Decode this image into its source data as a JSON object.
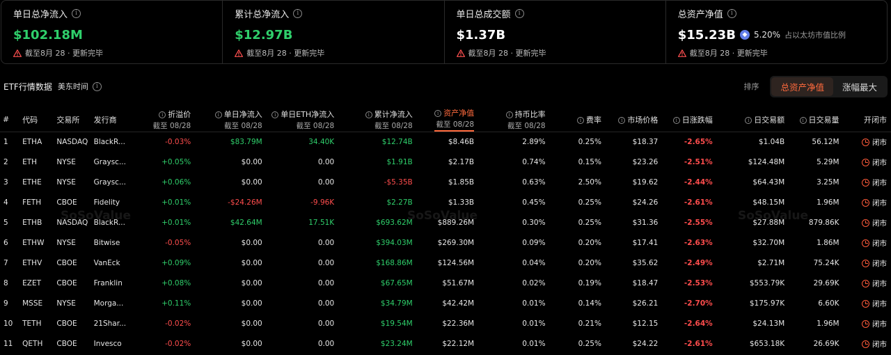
{
  "cards": [
    {
      "title": "单日总净流入",
      "value": "$102.18M",
      "color": "green",
      "note": "截至8月 28 · 更新完毕"
    },
    {
      "title": "累计总净流入",
      "value": "$12.97B",
      "color": "green",
      "note": "截至8月 28 · 更新完毕"
    },
    {
      "title": "单日总成交额",
      "value": "$1.37B",
      "color": "white",
      "note": "截至8月 28 · 更新完毕"
    },
    {
      "title": "总资产净值",
      "value": "$15.23B",
      "color": "white",
      "extra": "5.20%",
      "extra_label": "占以太坊市值比例",
      "note": "截至8月 28 · 更新完毕"
    }
  ],
  "section": {
    "title": "ETF行情数据",
    "timezone": "美东时间",
    "sort_label": "排序",
    "sort_options": [
      "总资产净值",
      "涨幅最大"
    ]
  },
  "watermark": "SoSoValue",
  "columns": {
    "num": "#",
    "code": "代码",
    "exchange": "交易所",
    "issuer": "发行商",
    "premium": "折溢价",
    "premium_sub": "截至 08/28",
    "daily_flow": "单日净流入",
    "daily_flow_sub": "截至 08/28",
    "daily_eth_flow": "单日ETH净流入",
    "daily_eth_flow_sub": "截至 08/28",
    "cum_flow": "累计净流入",
    "cum_flow_sub": "截至 08/28",
    "nav": "资产净值",
    "nav_sub": "截至 08/28",
    "holding_ratio": "持币比率",
    "holding_ratio_sub": "截至 08/28",
    "fee": "费率",
    "market_price": "市场价格",
    "daily_change": "日涨跌幅",
    "daily_value": "日交易额",
    "daily_volume": "日交易量",
    "status": "开闭市"
  },
  "rows": [
    {
      "num": "1",
      "code": "ETHA",
      "exchange": "NASDAQ",
      "issuer": "BlackR...",
      "premium": "-0.03%",
      "daily_flow": "$83.79M",
      "daily_eth_flow": "34.40K",
      "cum_flow": "$12.74B",
      "nav": "$8.46B",
      "holding_ratio": "2.89%",
      "fee": "0.25%",
      "price": "$18.37",
      "change": "-2.65%",
      "value": "$1.04B",
      "volume": "56.12M",
      "status": "闭市"
    },
    {
      "num": "2",
      "code": "ETH",
      "exchange": "NYSE",
      "issuer": "Graysc...",
      "premium": "+0.05%",
      "daily_flow": "$0.00",
      "daily_eth_flow": "0.00",
      "cum_flow": "$1.91B",
      "nav": "$2.17B",
      "holding_ratio": "0.74%",
      "fee": "0.15%",
      "price": "$23.26",
      "change": "-2.51%",
      "value": "$124.48M",
      "volume": "5.29M",
      "status": "闭市"
    },
    {
      "num": "3",
      "code": "ETHE",
      "exchange": "NYSE",
      "issuer": "Graysc...",
      "premium": "+0.06%",
      "daily_flow": "$0.00",
      "daily_eth_flow": "0.00",
      "cum_flow": "-$5.35B",
      "nav": "$1.85B",
      "holding_ratio": "0.63%",
      "fee": "2.50%",
      "price": "$19.62",
      "change": "-2.44%",
      "value": "$64.43M",
      "volume": "3.25M",
      "status": "闭市"
    },
    {
      "num": "4",
      "code": "FETH",
      "exchange": "CBOE",
      "issuer": "Fidelity",
      "premium": "+0.01%",
      "daily_flow": "-$24.26M",
      "daily_eth_flow": "-9.96K",
      "cum_flow": "$2.27B",
      "nav": "$1.33B",
      "holding_ratio": "0.45%",
      "fee": "0.25%",
      "price": "$24.26",
      "change": "-2.61%",
      "value": "$48.15M",
      "volume": "1.96M",
      "status": "闭市"
    },
    {
      "num": "5",
      "code": "ETHB",
      "exchange": "NASDAQ",
      "issuer": "BlackR...",
      "premium": "+0.01%",
      "daily_flow": "$42.64M",
      "daily_eth_flow": "17.51K",
      "cum_flow": "$693.62M",
      "nav": "$889.26M",
      "holding_ratio": "0.30%",
      "fee": "0.25%",
      "price": "$31.36",
      "change": "-2.55%",
      "value": "$27.88M",
      "volume": "879.86K",
      "status": "闭市"
    },
    {
      "num": "6",
      "code": "ETHW",
      "exchange": "NYSE",
      "issuer": "Bitwise",
      "premium": "-0.05%",
      "daily_flow": "$0.00",
      "daily_eth_flow": "0.00",
      "cum_flow": "$394.03M",
      "nav": "$269.30M",
      "holding_ratio": "0.09%",
      "fee": "0.20%",
      "price": "$17.41",
      "change": "-2.63%",
      "value": "$32.70M",
      "volume": "1.86M",
      "status": "闭市"
    },
    {
      "num": "7",
      "code": "ETHV",
      "exchange": "CBOE",
      "issuer": "VanEck",
      "premium": "+0.09%",
      "daily_flow": "$0.00",
      "daily_eth_flow": "0.00",
      "cum_flow": "$168.86M",
      "nav": "$124.56M",
      "holding_ratio": "0.04%",
      "fee": "0.20%",
      "price": "$35.62",
      "change": "-2.49%",
      "value": "$2.71M",
      "volume": "75.24K",
      "status": "闭市"
    },
    {
      "num": "8",
      "code": "EZET",
      "exchange": "CBOE",
      "issuer": "Franklin",
      "premium": "+0.08%",
      "daily_flow": "$0.00",
      "daily_eth_flow": "0.00",
      "cum_flow": "$67.65M",
      "nav": "$51.67M",
      "holding_ratio": "0.02%",
      "fee": "0.19%",
      "price": "$18.47",
      "change": "-2.53%",
      "value": "$553.79K",
      "volume": "29.69K",
      "status": "闭市"
    },
    {
      "num": "9",
      "code": "MSSE",
      "exchange": "NYSE",
      "issuer": "Morga...",
      "premium": "+0.11%",
      "daily_flow": "$0.00",
      "daily_eth_flow": "0.00",
      "cum_flow": "$34.79M",
      "nav": "$42.42M",
      "holding_ratio": "0.01%",
      "fee": "0.14%",
      "price": "$26.21",
      "change": "-2.70%",
      "value": "$175.97K",
      "volume": "6.60K",
      "status": "闭市"
    },
    {
      "num": "10",
      "code": "TETH",
      "exchange": "CBOE",
      "issuer": "21Shar...",
      "premium": "-0.02%",
      "daily_flow": "$0.00",
      "daily_eth_flow": "0.00",
      "cum_flow": "$19.54M",
      "nav": "$22.36M",
      "holding_ratio": "0.01%",
      "fee": "0.21%",
      "price": "$12.15",
      "change": "-2.64%",
      "value": "$24.13M",
      "volume": "1.96M",
      "status": "闭市"
    },
    {
      "num": "11",
      "code": "QETH",
      "exchange": "CBOE",
      "issuer": "Invesco",
      "premium": "-0.02%",
      "daily_flow": "$0.00",
      "daily_eth_flow": "0.00",
      "cum_flow": "$23.24M",
      "nav": "$22.12M",
      "holding_ratio": "0.01%",
      "fee": "0.25%",
      "price": "$24.22",
      "change": "-2.61%",
      "value": "$653.18K",
      "volume": "26.69K",
      "status": "闭市"
    }
  ]
}
